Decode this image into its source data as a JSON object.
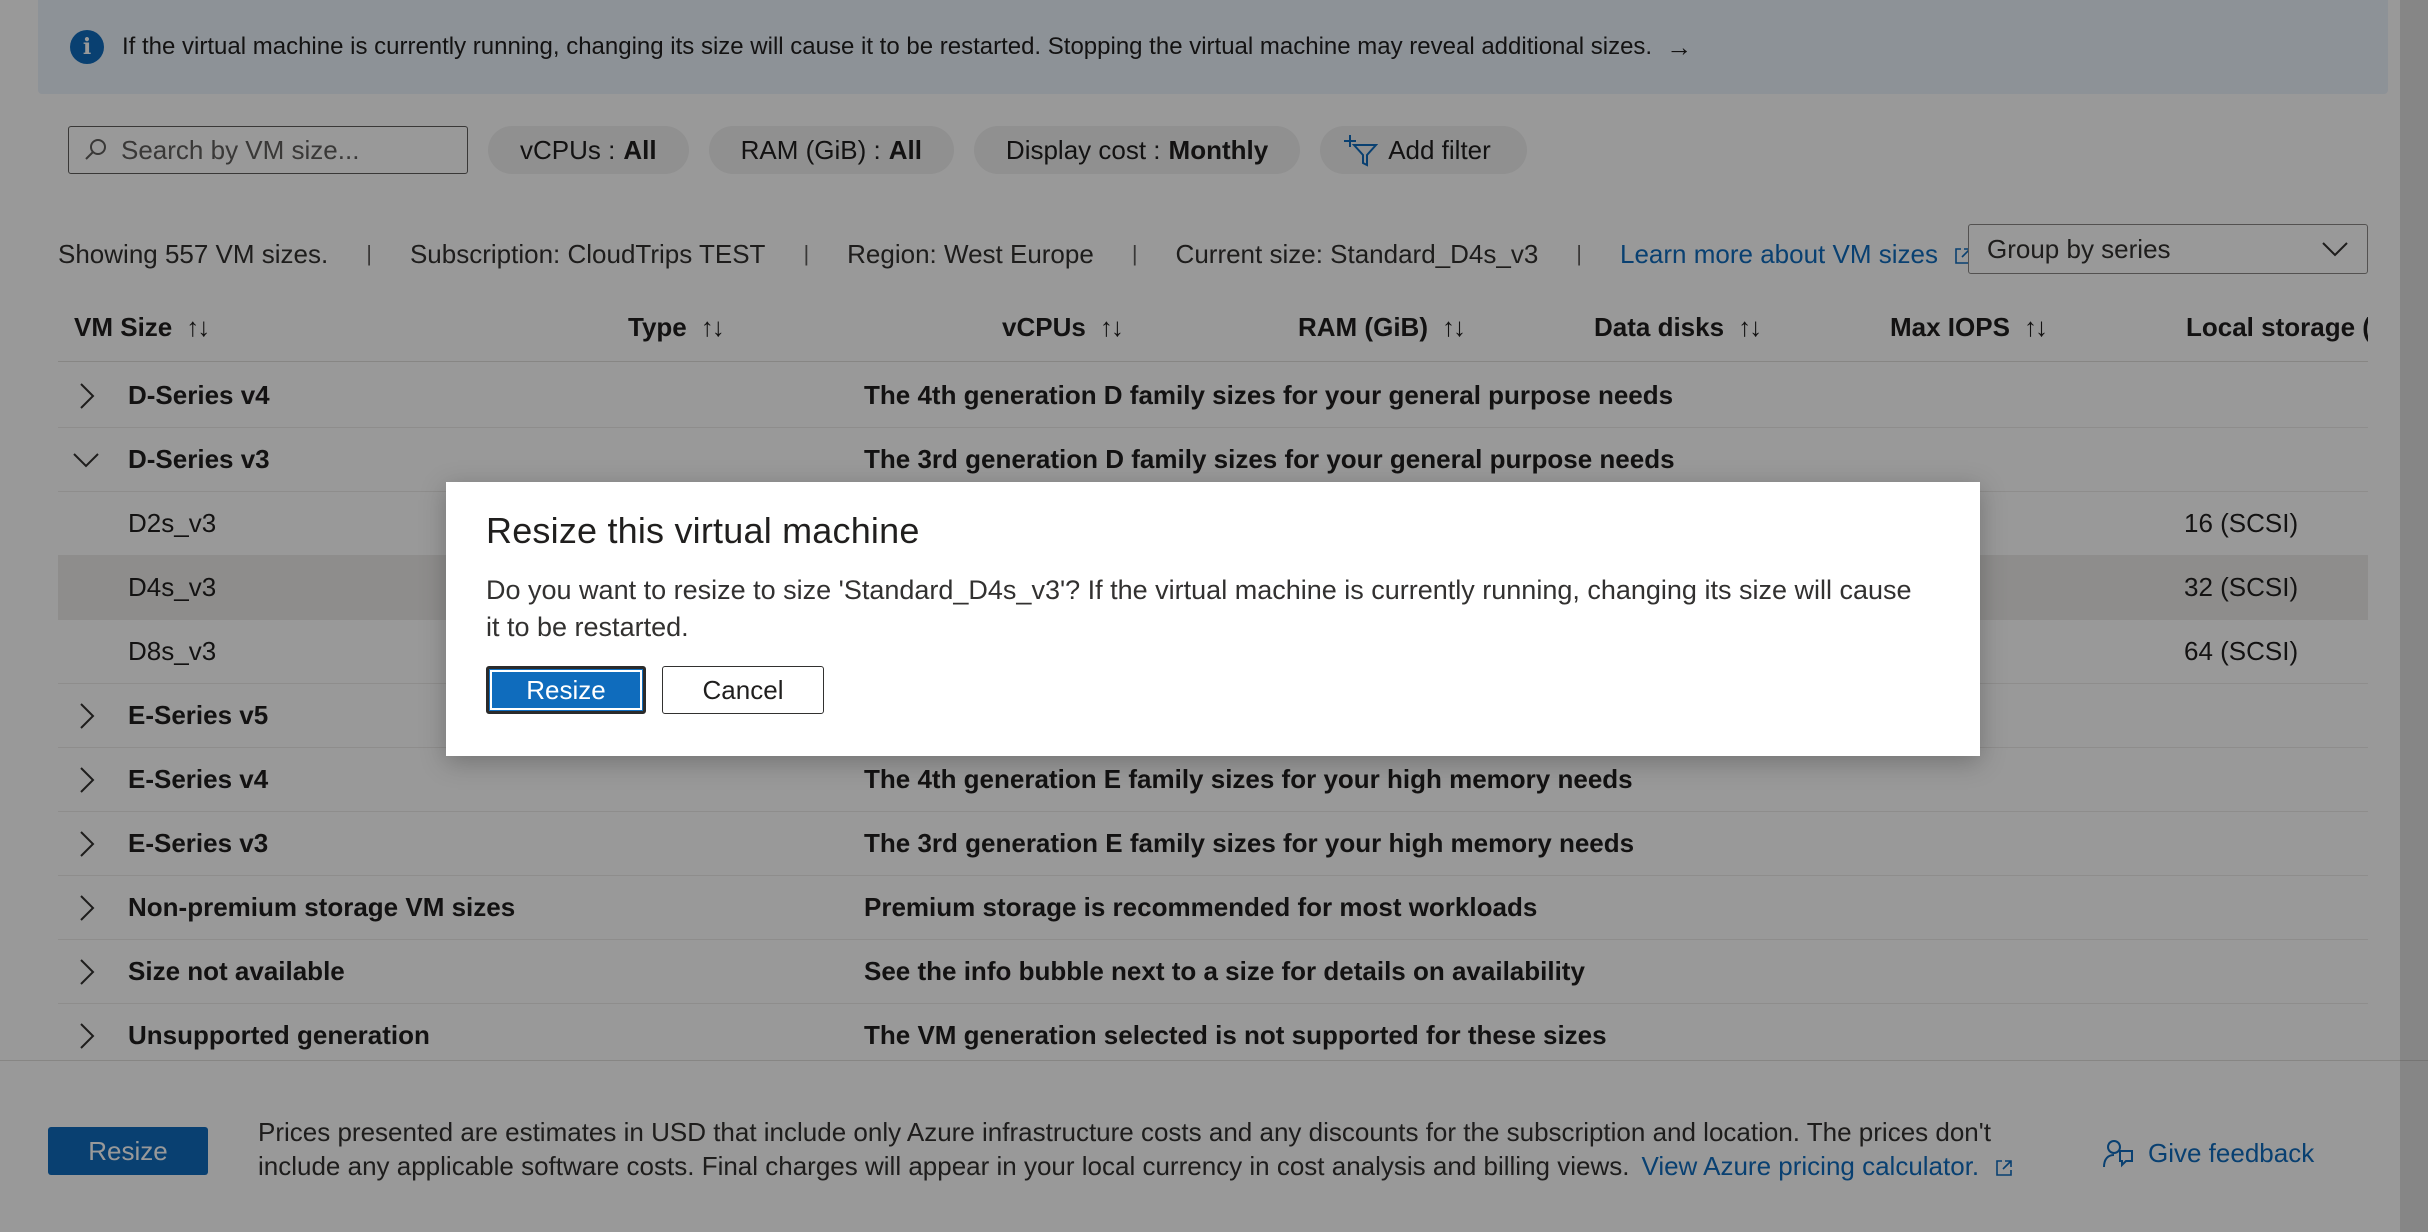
{
  "banner": {
    "icon": "info-icon",
    "text": "If the virtual machine is currently running, changing its size will cause it to be restarted. Stopping the virtual machine may reveal additional sizes.",
    "arrow": "→"
  },
  "toolbar": {
    "search_placeholder": "Search by VM size...",
    "filters": [
      {
        "label": "vCPUs : ",
        "value": "All"
      },
      {
        "label": "RAM (GiB) : ",
        "value": "All"
      },
      {
        "label": "Display cost : ",
        "value": "Monthly"
      }
    ],
    "add_filter": "Add filter"
  },
  "summary": {
    "showing": "Showing 557 VM sizes.",
    "subscription": "Subscription: CloudTrips TEST",
    "region": "Region: West Europe",
    "current_size": "Current size: Standard_D4s_v3",
    "learn_more": "Learn more about VM sizes",
    "separator": "|"
  },
  "group_by": {
    "selected": "Group by series"
  },
  "table": {
    "headers": [
      "VM Size",
      "Type",
      "vCPUs",
      "RAM (GiB)",
      "Data disks",
      "Max IOPS",
      "Local storage (G"
    ],
    "sort_glyph": "↑↓",
    "rows": [
      {
        "kind": "group",
        "expanded": false,
        "name": "D-Series v4",
        "desc": "The 4th generation D family sizes for your general purpose needs"
      },
      {
        "kind": "group",
        "expanded": true,
        "name": "D-Series v3",
        "desc": "The 3rd generation D family sizes for your general purpose needs"
      },
      {
        "kind": "item",
        "name": "D2s_v3",
        "local": "16 (SCSI)"
      },
      {
        "kind": "item",
        "name": "D4s_v3",
        "local": "32 (SCSI)",
        "selected": true
      },
      {
        "kind": "item",
        "name": "D8s_v3",
        "local": "64 (SCSI)"
      },
      {
        "kind": "group",
        "expanded": false,
        "name": "E-Series v5",
        "desc": ""
      },
      {
        "kind": "group",
        "expanded": false,
        "name": "E-Series v4",
        "desc": "The 4th generation E family sizes for your high memory needs"
      },
      {
        "kind": "group",
        "expanded": false,
        "name": "E-Series v3",
        "desc": "The 3rd generation E family sizes for your high memory needs"
      },
      {
        "kind": "group",
        "expanded": false,
        "name": "Non-premium storage VM sizes",
        "desc": "Premium storage is recommended for most workloads"
      },
      {
        "kind": "group",
        "expanded": false,
        "name": "Size not available",
        "desc": "See the info bubble next to a size for details on availability"
      },
      {
        "kind": "group",
        "expanded": false,
        "name": "Unsupported generation",
        "desc": "The VM generation selected is not supported for these sizes"
      }
    ]
  },
  "footer": {
    "resize_label": "Resize",
    "text": "Prices presented are estimates in USD that include only Azure infrastructure costs and any discounts for the subscription and location. The prices don't include any applicable software costs. Final charges will appear in your local currency in cost analysis and billing views.",
    "pricing_link": "View Azure pricing calculator.",
    "feedback": "Give feedback"
  },
  "dialog": {
    "title": "Resize this virtual machine",
    "message": "Do you want to resize to size 'Standard_D4s_v3'? If the virtual machine is currently running, changing its size will cause it to be restarted.",
    "confirm": "Resize",
    "cancel": "Cancel"
  },
  "colors": {
    "accent": "#0f6cbd",
    "banner_bg": "#ebf3fc",
    "overlay": "rgba(0,0,0,0.4)"
  }
}
